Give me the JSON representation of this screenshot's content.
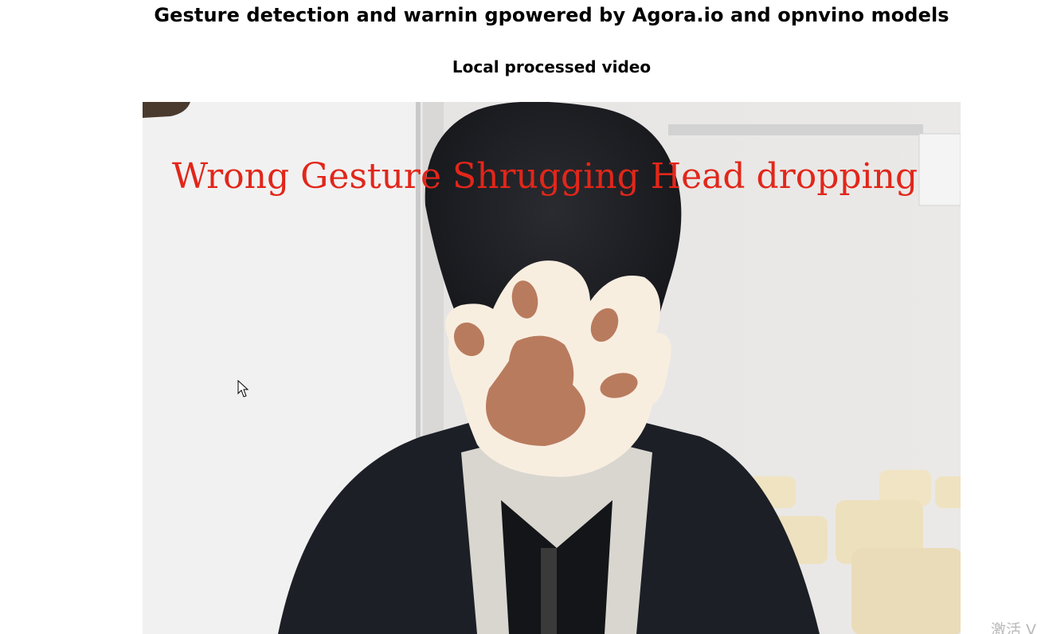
{
  "page": {
    "title": "Gesture detection and warnin gpowered by Agora.io and opnvino models",
    "video_heading": "Local processed video"
  },
  "video": {
    "overlay_text": "Wrong Gesture Shrugging Head dropping",
    "overlay_color": "#e2261a",
    "face_cover_icon": "paw-icon",
    "paw_colors": {
      "fill": "#f8eee0",
      "pads": "#b97b5e"
    }
  },
  "watermark": {
    "text": "激活 V"
  }
}
